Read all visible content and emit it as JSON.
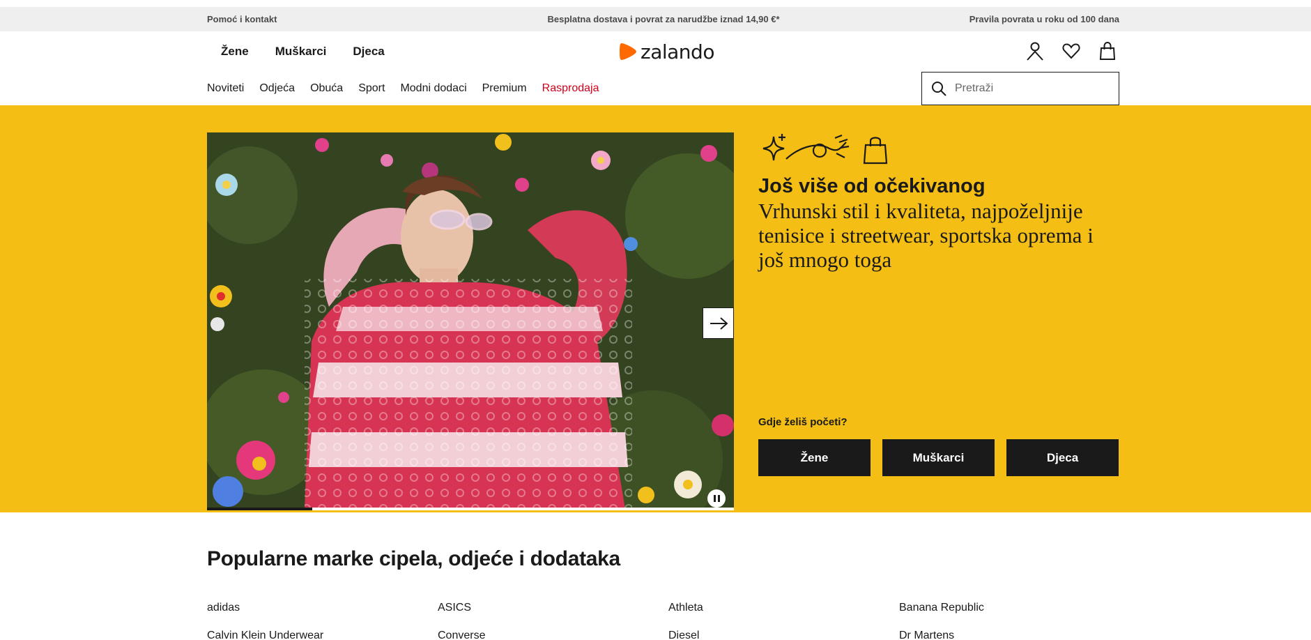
{
  "topbar": {
    "left": "Pomoć i kontakt",
    "center": "Besplatna dostava i povrat za narudžbe iznad 14,90 €*",
    "right": "Pravila povrata u roku od 100 dana"
  },
  "header": {
    "gender_nav": [
      "Žene",
      "Muškarci",
      "Djeca"
    ],
    "logo_text": "zalando",
    "icons": [
      "account-icon",
      "wishlist-heart-icon",
      "shopping-bag-icon"
    ],
    "categories": [
      "Noviteti",
      "Odjeća",
      "Obuća",
      "Sport",
      "Modni dodaci",
      "Premium",
      "Rasprodaja"
    ],
    "search_placeholder": "Pretraži"
  },
  "hero": {
    "title": "Još više od očekivanog",
    "subtitle": "Vrhunski stil i kvaliteta, najpoželjnije tenisice i streetwear, sportska oprema i još mnogo toga",
    "question": "Gdje želiš početi?",
    "buttons": [
      "Žene",
      "Muškarci",
      "Djeca"
    ],
    "slide_progress": 0.2,
    "colors": {
      "background": "#f5be15",
      "button_bg": "#1a1a1a",
      "button_text": "#ffffff"
    }
  },
  "brands": {
    "title": "Popularne marke cipela, odjeće i dodataka",
    "items": [
      "adidas",
      "ASICS",
      "Athleta",
      "Banana Republic",
      "Calvin Klein Underwear",
      "Converse",
      "Diesel",
      "Dr Martens"
    ]
  },
  "colors": {
    "accent": "#ff6900",
    "sale": "#d0021b",
    "topbar_bg": "#efeff0"
  }
}
